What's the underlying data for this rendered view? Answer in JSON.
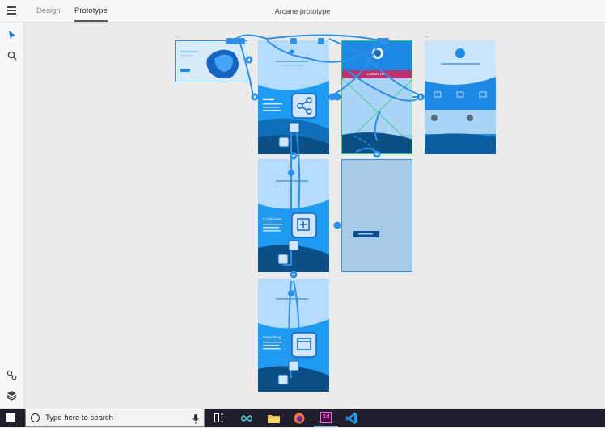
{
  "app": {
    "tabs": [
      {
        "label": "Design",
        "active": false
      },
      {
        "label": "Prototype",
        "active": true
      }
    ],
    "document_title": "Arcane prototype"
  },
  "toolbar": {
    "tools": [
      {
        "name": "select-tool",
        "icon": "arrow-pointer-icon"
      },
      {
        "name": "zoom-tool",
        "icon": "search-icon"
      }
    ],
    "bottom_tools": [
      {
        "name": "plugins-tool",
        "icon": "plugins-icon"
      },
      {
        "name": "layers-tool",
        "icon": "layers-icon"
      }
    ]
  },
  "artboards": {
    "label_marker": "...",
    "hero_section": "Design",
    "collaborate_section": "Collaborate",
    "scheduling_section": "Scheduling",
    "contact_button": "Contact Us",
    "brand_color": "#1e88e5",
    "wire_color": "#2f8fe6",
    "selected_color": "#2ecc71"
  },
  "taskbar": {
    "search_placeholder": "Type here to search",
    "apps": [
      {
        "name": "task-view",
        "icon": "task-view-icon"
      },
      {
        "name": "infinity-app",
        "icon": "infinity-icon"
      },
      {
        "name": "file-explorer",
        "icon": "folder-icon"
      },
      {
        "name": "firefox",
        "icon": "firefox-icon"
      },
      {
        "name": "adobe-xd",
        "icon": "xd-icon",
        "label": "Xd",
        "open": true
      },
      {
        "name": "vs-code",
        "icon": "vscode-icon"
      }
    ]
  }
}
